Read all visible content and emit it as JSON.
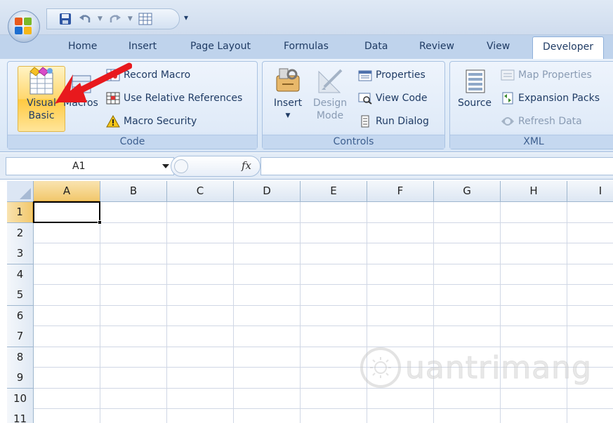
{
  "tabs": [
    "Home",
    "Insert",
    "Page Layout",
    "Formulas",
    "Data",
    "Review",
    "View",
    "Developer"
  ],
  "active_tab": "Developer",
  "ribbon": {
    "code": {
      "label": "Code",
      "visual_basic_line1": "Visual",
      "visual_basic_line2": "Basic",
      "macros": "Macros",
      "record_macro": "Record Macro",
      "use_relative_references": "Use Relative References",
      "macro_security": "Macro Security"
    },
    "controls": {
      "label": "Controls",
      "insert": "Insert",
      "design_mode_line1": "Design",
      "design_mode_line2": "Mode",
      "properties": "Properties",
      "view_code": "View Code",
      "run_dialog": "Run Dialog"
    },
    "xml": {
      "label": "XML",
      "source": "Source",
      "map_properties": "Map Properties",
      "expansion_packs": "Expansion Packs",
      "refresh_data": "Refresh Data"
    }
  },
  "formula_bar": {
    "name_box": "A1",
    "fx": "fx",
    "value": ""
  },
  "sheet": {
    "columns": [
      "A",
      "B",
      "C",
      "D",
      "E",
      "F",
      "G",
      "H",
      "I"
    ],
    "rows": [
      "1",
      "2",
      "3",
      "4",
      "5",
      "6",
      "7",
      "8",
      "9",
      "10",
      "11"
    ],
    "active_cell": "A1"
  },
  "watermark": "uantrimang",
  "colors": {
    "accent": "#15428b",
    "annotation_arrow": "#e8191d",
    "selection_header": "#f2c86c"
  },
  "icons": {
    "office_button": "office-logo-icon",
    "save": "save-icon",
    "undo": "undo-icon",
    "redo": "redo-icon",
    "table": "table-icon"
  }
}
